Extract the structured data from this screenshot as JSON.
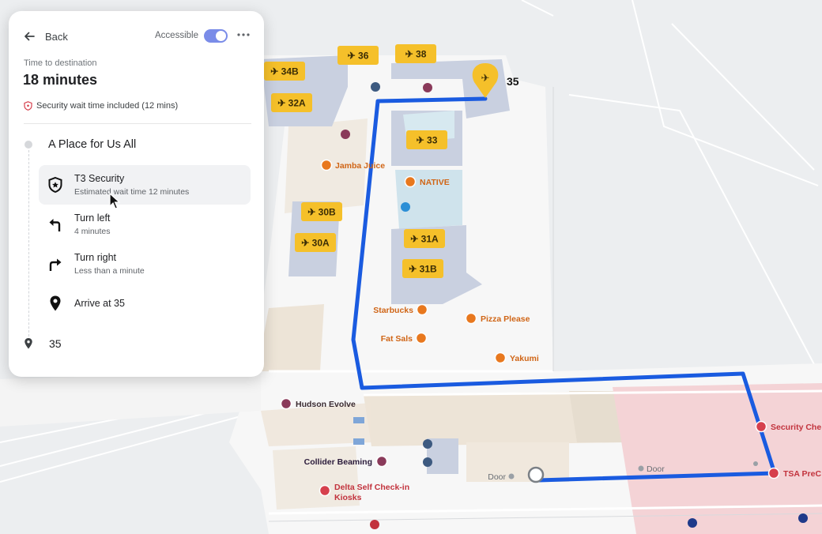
{
  "panel": {
    "back_label": "Back",
    "accessible_label": "Accessible",
    "accessible_on": true,
    "time_label": "Time to destination",
    "duration": "18 minutes",
    "security_note": "Security wait time included (12 mins)",
    "start": "A Place for Us All",
    "steps": [
      {
        "title": "T3 Security",
        "subtitle": "Estimated wait time 12 minutes",
        "icon": "shield-star-icon"
      },
      {
        "title": "Turn left",
        "subtitle": "4 minutes",
        "icon": "turn-left-icon"
      },
      {
        "title": "Turn right",
        "subtitle": "Less than a minute",
        "icon": "turn-right-icon"
      },
      {
        "title": "Arrive at 35",
        "subtitle": "",
        "icon": "pin-icon"
      }
    ],
    "destination": "35"
  },
  "map": {
    "gates": [
      "34B",
      "36",
      "38",
      "32A",
      "33",
      "30B",
      "30A",
      "31A",
      "31B"
    ],
    "destination_gate": "35",
    "places": [
      "Jamba Juice",
      "NATIVE",
      "Starbucks",
      "Pizza Please",
      "Fat Sals",
      "Yakumi",
      "Hudson Evolve",
      "Collider Beaming",
      "Delta Self Check-in",
      "Kiosks",
      "Security Che",
      "TSA PreC"
    ],
    "doors": [
      "Door",
      "Door"
    ],
    "route_color": "#1a5be0",
    "food_color": "#e8781e",
    "shop_color": "#8a3a5a",
    "security_color": "#d6404d",
    "gate_color": "#f5c02a"
  }
}
